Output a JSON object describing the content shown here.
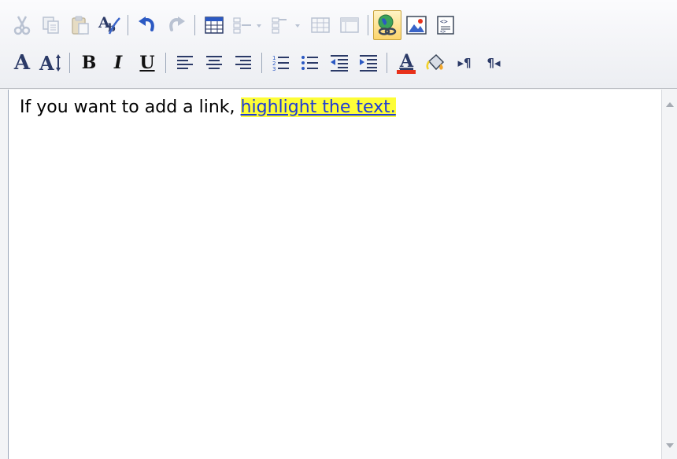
{
  "editor": {
    "content": {
      "plain_text": "If you want to add a link, ",
      "highlighted_text": "highlight the text. "
    },
    "toolbar": {
      "row1": [
        {
          "id": "cut",
          "icon": "scissors-icon",
          "enabled": false
        },
        {
          "id": "copy",
          "icon": "copy-icon",
          "enabled": false
        },
        {
          "id": "paste",
          "icon": "paste-icon",
          "enabled": false
        },
        {
          "id": "spellcheck",
          "icon": "spellcheck-icon",
          "enabled": true
        },
        {
          "id": "undo",
          "icon": "undo-icon",
          "enabled": true
        },
        {
          "id": "redo",
          "icon": "redo-icon",
          "enabled": false
        },
        {
          "id": "insert-table",
          "icon": "table-icon",
          "enabled": true
        },
        {
          "id": "insert-row",
          "icon": "insert-row-icon",
          "enabled": false
        },
        {
          "id": "insert-column",
          "icon": "insert-column-icon",
          "enabled": false
        },
        {
          "id": "merge-cells",
          "icon": "merge-cells-icon",
          "enabled": false
        },
        {
          "id": "split-cells",
          "icon": "split-cells-icon",
          "enabled": false
        },
        {
          "id": "insert-link",
          "icon": "hyperlink-icon",
          "enabled": true,
          "hovered": true
        },
        {
          "id": "insert-image",
          "icon": "image-icon",
          "enabled": true
        },
        {
          "id": "html-source",
          "icon": "html-source-icon",
          "enabled": true
        }
      ],
      "row2": [
        {
          "id": "font-style",
          "icon": "font-icon",
          "glyph": "A"
        },
        {
          "id": "font-size",
          "icon": "font-size-icon",
          "glyph": "A"
        },
        {
          "id": "bold",
          "icon": "bold-icon",
          "glyph": "B"
        },
        {
          "id": "italic",
          "icon": "italic-icon",
          "glyph": "I"
        },
        {
          "id": "underline",
          "icon": "underline-icon",
          "glyph": "U"
        },
        {
          "id": "align-left",
          "icon": "align-left-icon"
        },
        {
          "id": "align-center",
          "icon": "align-center-icon"
        },
        {
          "id": "align-right",
          "icon": "align-right-icon"
        },
        {
          "id": "numbered-list",
          "icon": "numbered-list-icon"
        },
        {
          "id": "bulleted-list",
          "icon": "bulleted-list-icon"
        },
        {
          "id": "decrease-indent",
          "icon": "outdent-icon"
        },
        {
          "id": "increase-indent",
          "icon": "indent-icon"
        },
        {
          "id": "font-color",
          "icon": "font-color-icon",
          "glyph": "A"
        },
        {
          "id": "highlight-color",
          "icon": "paint-bucket-icon"
        },
        {
          "id": "ltr",
          "icon": "ltr-icon",
          "glyph": "▸¶"
        },
        {
          "id": "rtl",
          "icon": "rtl-icon",
          "glyph": "¶◂"
        }
      ]
    },
    "colors": {
      "toolbar_icon": "#2b3a67",
      "disabled_icon": "#b9c2d2",
      "highlight_background": "#fdfd37",
      "link_text": "#1f3bd6",
      "font_color_bar": "#e8311a",
      "hover_background": "#fcd56d"
    }
  }
}
